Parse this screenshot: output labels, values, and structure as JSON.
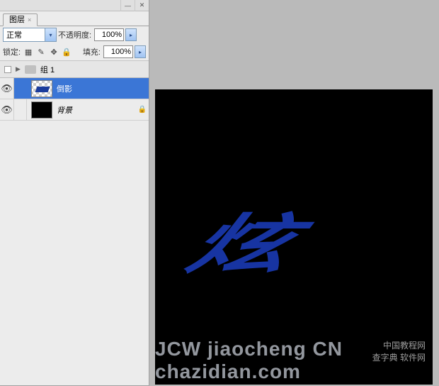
{
  "panel": {
    "tab": "图层",
    "blend_mode": "正常",
    "opacity_label": "不透明度:",
    "opacity_value": "100%",
    "lock_label": "锁定:",
    "fill_label": "填充:",
    "fill_value": "100%"
  },
  "group": {
    "name": "组 1"
  },
  "layers": [
    {
      "name": "倒影",
      "selected": true,
      "thumb": "checker-mini"
    },
    {
      "name": "背景",
      "selected": false,
      "thumb": "black",
      "locked": true
    }
  ],
  "canvas": {
    "glyph": "炫",
    "watermark_cn_line1": "中国教程网",
    "watermark_cn_line2": "查字典   软件网",
    "watermark_en": "JCW jiaocheng CN   chazidian.com"
  }
}
